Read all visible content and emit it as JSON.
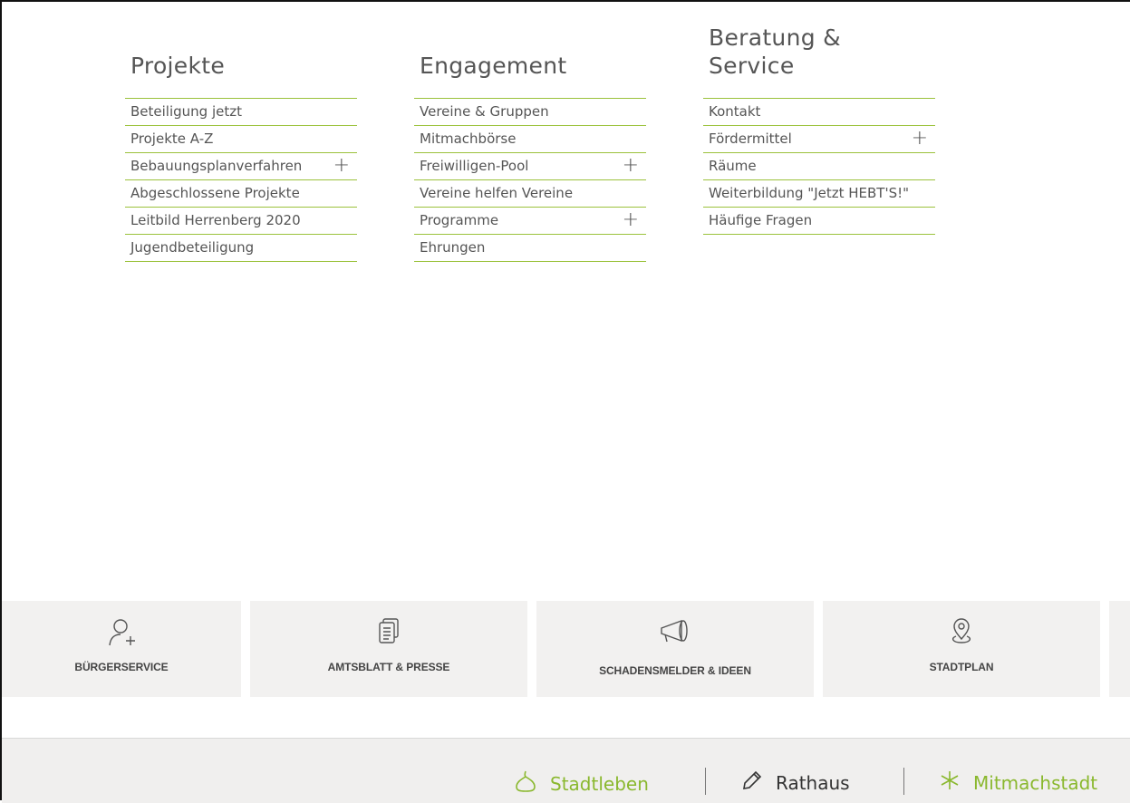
{
  "columns": [
    {
      "title": "Projekte",
      "items": [
        {
          "label": "Beteiligung jetzt",
          "expandable": false
        },
        {
          "label": "Projekte A-Z",
          "expandable": false
        },
        {
          "label": "Bebauungsplanverfahren",
          "expandable": true
        },
        {
          "label": "Abgeschlossene Projekte",
          "expandable": false
        },
        {
          "label": "Leitbild Herrenberg 2020",
          "expandable": false
        },
        {
          "label": "Jugendbeteiligung",
          "expandable": false
        }
      ]
    },
    {
      "title": "Engagement",
      "items": [
        {
          "label": "Vereine & Gruppen",
          "expandable": false
        },
        {
          "label": "Mitmachbörse",
          "expandable": false
        },
        {
          "label": "Freiwilligen-Pool",
          "expandable": true
        },
        {
          "label": "Vereine helfen Vereine",
          "expandable": false
        },
        {
          "label": "Programme",
          "expandable": true
        },
        {
          "label": "Ehrungen",
          "expandable": false
        }
      ]
    },
    {
      "title_line1": "Beratung &",
      "title_line2": "Service",
      "items": [
        {
          "label": "Kontakt",
          "expandable": false
        },
        {
          "label": "Fördermittel",
          "expandable": true
        },
        {
          "label": "Räume",
          "expandable": false
        },
        {
          "label": "Weiterbildung \"Jetzt HEBT'S!\"",
          "expandable": false
        },
        {
          "label": "Häufige Fragen",
          "expandable": false
        }
      ]
    }
  ],
  "expand_symbol": "+",
  "tiles": [
    {
      "label": "BÜRGERSERVICE",
      "icon": "person-add-icon"
    },
    {
      "label": "AMTSBLATT & PRESSE",
      "icon": "documents-icon"
    },
    {
      "label": "SCHADENSMELDER & IDEEN",
      "icon": "megaphone-icon"
    },
    {
      "label": "STADTPLAN",
      "icon": "map-pin-icon"
    }
  ],
  "footer": {
    "items": [
      {
        "label": "Stadtleben",
        "icon": "drop-icon",
        "color": "#8ab82e"
      },
      {
        "label": "Rathaus",
        "icon": "pencil-icon",
        "color": "#333333"
      },
      {
        "label": "Mitmachstadt",
        "icon": "asterisk-icon",
        "color": "#8ab82e"
      }
    ]
  },
  "colors": {
    "accent": "#9bc23c",
    "tile_bg": "#f2f1f0",
    "text": "#555555"
  }
}
